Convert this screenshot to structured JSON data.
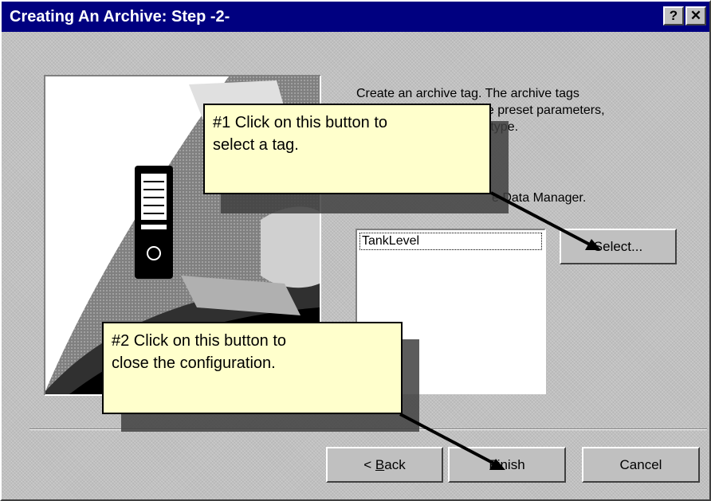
{
  "window": {
    "title": "Creating An Archive: Step -2-",
    "help_label": "?",
    "close_label": "✕"
  },
  "description": {
    "line1": "Create an archive tag. The archive tags",
    "line2_fragment": "he preset parameters,",
    "line3_fragment": "g type.",
    "line4_fragment": "e Data Manager."
  },
  "tag_list": {
    "items": [
      "TankLevel"
    ]
  },
  "buttons": {
    "select": "Select...",
    "back_prefix": "< ",
    "back_underlined": "B",
    "back_rest": "ack",
    "finish": "Finish",
    "cancel": "Cancel"
  },
  "callouts": {
    "one_line1": "#1  Click on this button to",
    "one_line2": "select a tag.",
    "two_line1": "#2 Click on this button to",
    "two_line2": "close the configuration."
  },
  "colors": {
    "titlebar": "#000080",
    "dialog_face": "#c0c0c0",
    "callout_fill": "#ffffcc"
  },
  "icons": {
    "wizard_illustration": "device-illustration",
    "help": "help-icon",
    "close": "close-icon"
  }
}
